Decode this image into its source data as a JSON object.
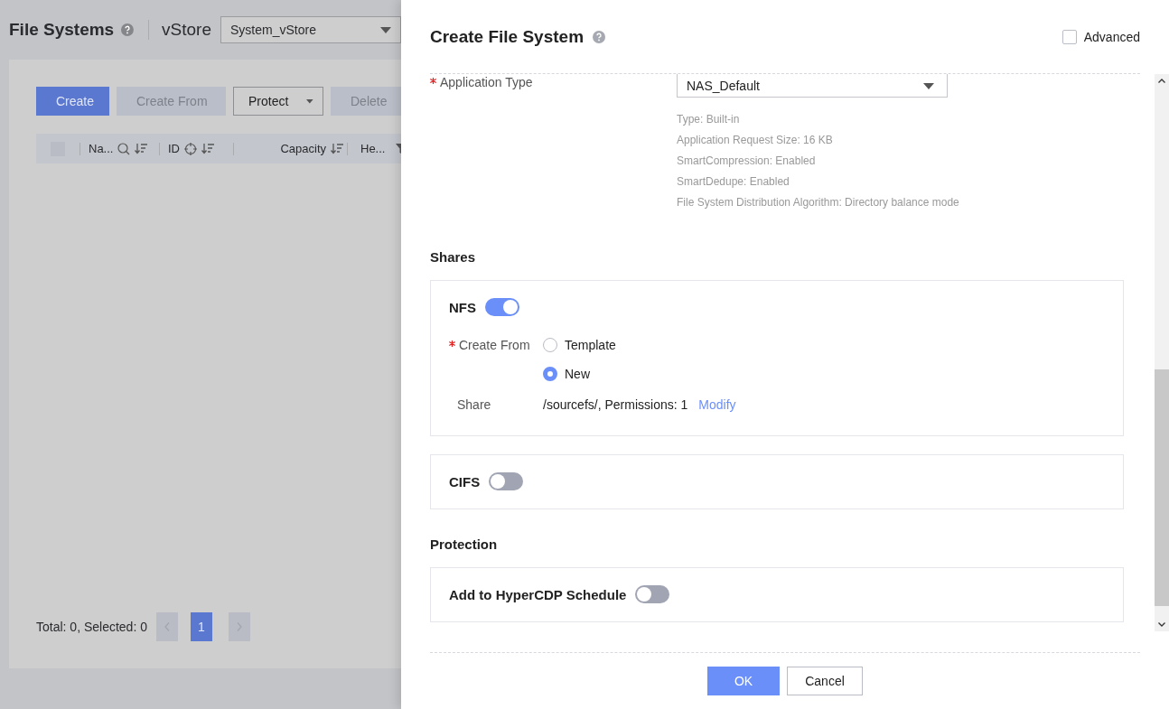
{
  "page": {
    "title": "File Systems",
    "vstore_label": "vStore",
    "vstore_value": "System_vStore",
    "toolbar": [
      {
        "label": "Create",
        "kind": "primary",
        "disabled": false
      },
      {
        "label": "Create From",
        "kind": "plain",
        "disabled": true
      },
      {
        "label": "Protect",
        "kind": "dropdown",
        "disabled": false
      },
      {
        "label": "Delete",
        "kind": "plain",
        "disabled": true
      }
    ],
    "table": {
      "select_all_checked": false,
      "columns": [
        {
          "label": "Na..."
        },
        {
          "label": "ID"
        },
        {
          "label": "Capacity"
        },
        {
          "label": "He..."
        }
      ]
    },
    "footer": {
      "summary": "Total: 0, Selected: 0",
      "pages": [
        {
          "label": "1",
          "selected": true
        }
      ]
    }
  },
  "dialog": {
    "title": "Create File System",
    "advanced": {
      "label": "Advanced",
      "checked": false
    },
    "application_type": {
      "label": "Application Type",
      "required": true,
      "value": "NAS_Default",
      "details": [
        "Type: Built-in",
        "Application Request Size: 16 KB",
        "SmartCompression: Enabled",
        "SmartDedupe: Enabled",
        "File System Distribution Algorithm: Directory balance mode"
      ]
    },
    "sections": [
      {
        "title": "Shares",
        "panels": [
          {
            "label": "NFS",
            "on": true,
            "create_from": {
              "label": "Create From",
              "required": true,
              "options": [
                {
                  "label": "Template",
                  "selected": false
                },
                {
                  "label": "New",
                  "selected": true
                }
              ]
            },
            "share": {
              "label": "Share",
              "value": "/sourcefs/, Permissions: 1",
              "link": "Modify"
            }
          },
          {
            "label": "CIFS",
            "on": false
          }
        ]
      },
      {
        "title": "Protection",
        "panels": [
          {
            "label": "Add to HyperCDP Schedule",
            "on": false
          }
        ]
      }
    ],
    "buttons": [
      {
        "label": "OK",
        "kind": "primary"
      },
      {
        "label": "Cancel",
        "kind": "plain"
      }
    ]
  }
}
